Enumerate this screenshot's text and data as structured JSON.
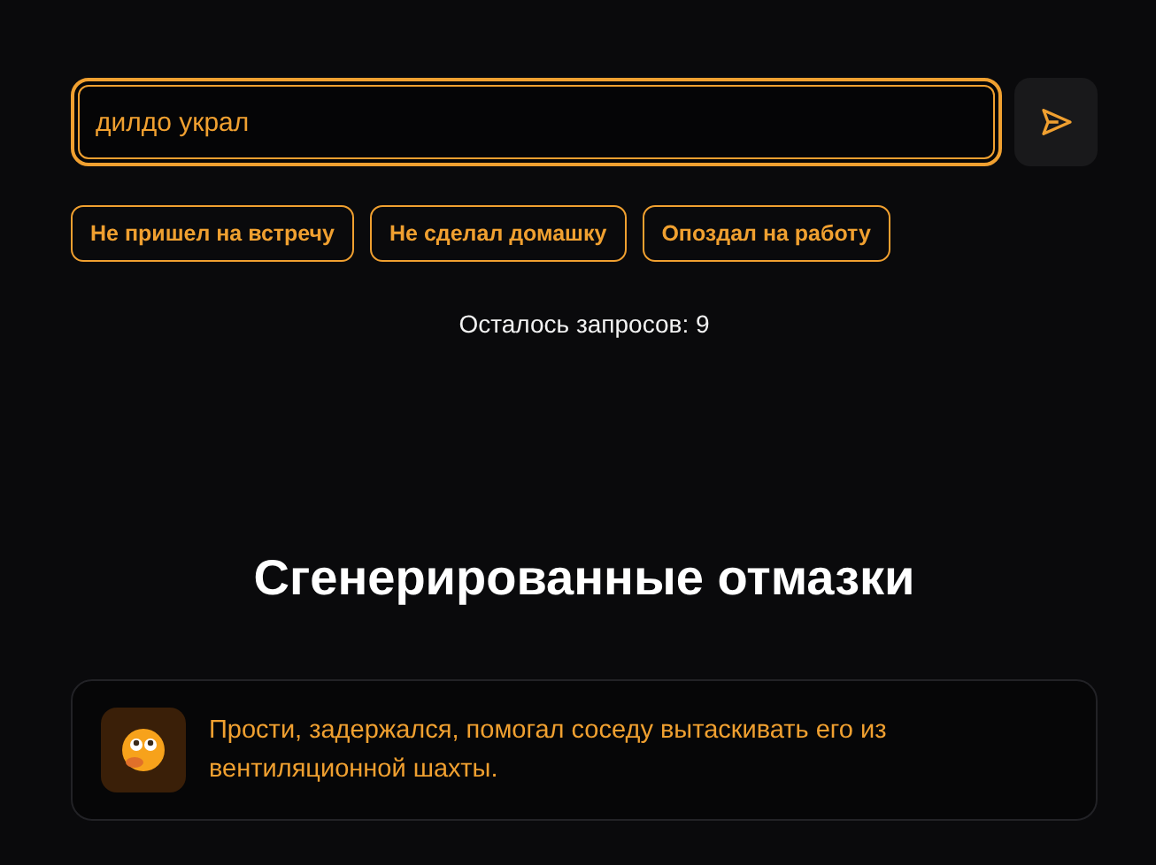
{
  "prompt": {
    "value": "дилдо украл"
  },
  "suggestions": [
    "Не пришел на встречу",
    "Не сделал домашку",
    "Опоздал на работу"
  ],
  "remaining": "Осталось запросов: 9",
  "heading": "Сгенерированные отмазки",
  "excuses": [
    {
      "text": "Прости, задержался, помогал соседу вытаскивать его из вентиляционной шахты."
    }
  ]
}
